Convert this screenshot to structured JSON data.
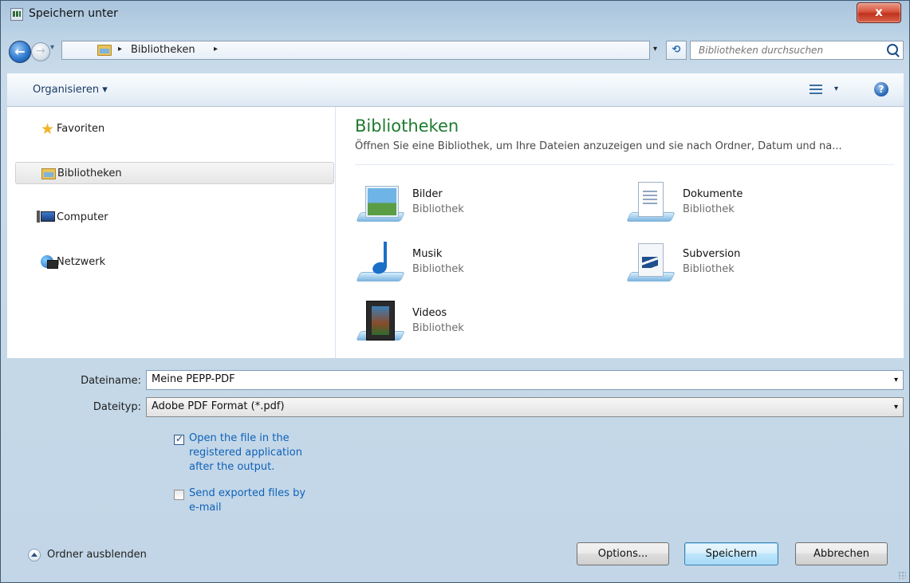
{
  "window": {
    "title": "Speichern unter",
    "close_label": "x"
  },
  "nav": {
    "back_label": "←",
    "forward_label": "→",
    "history_label": "▾",
    "breadcrumb": {
      "sep": "▸",
      "item": "Bibliotheken"
    },
    "crumb_drop": "▾",
    "refresh_label": "⟲",
    "search": {
      "placeholder": "Bibliotheken durchsuchen"
    }
  },
  "toolbar": {
    "organize": "Organisieren ▾",
    "view_drop": "▾",
    "help": "?"
  },
  "sidebar": {
    "items": [
      {
        "label": "Favoriten"
      },
      {
        "label": "Bibliotheken"
      },
      {
        "label": "Computer"
      },
      {
        "label": "Netzwerk"
      }
    ]
  },
  "main": {
    "title": "Bibliotheken",
    "description": "Öffnen Sie eine Bibliothek, um Ihre Dateien anzuzeigen und sie nach Ordner, Datum und na...",
    "libraries": [
      {
        "name": "Bilder",
        "type": "Bibliothek",
        "icon": "pictures-library-icon"
      },
      {
        "name": "Dokumente",
        "type": "Bibliothek",
        "icon": "documents-library-icon"
      },
      {
        "name": "Musik",
        "type": "Bibliothek",
        "icon": "music-library-icon"
      },
      {
        "name": "Subversion",
        "type": "Bibliothek",
        "icon": "subversion-library-icon"
      },
      {
        "name": "Videos",
        "type": "Bibliothek",
        "icon": "videos-library-icon"
      }
    ]
  },
  "form": {
    "filename_label": "Dateiname:",
    "filename_value": "Meine PEPP-PDF",
    "filetype_label": "Dateityp:",
    "filetype_value": "Adobe PDF Format (*.pdf)",
    "combo_arrow": "▾",
    "option_open": {
      "text": "Open the file in the\nregistered application\nafter the output.",
      "checked": true
    },
    "option_email": {
      "text": "Send exported files by\ne-mail",
      "checked": false
    },
    "hide_folders": "Ordner ausblenden"
  },
  "buttons": {
    "options": "Options...",
    "save": "Speichern",
    "cancel": "Abbrechen"
  },
  "colors": {
    "accent_title": "#1e7b2f",
    "link_blue": "#0f62b8",
    "close_red": "#c0321d"
  }
}
